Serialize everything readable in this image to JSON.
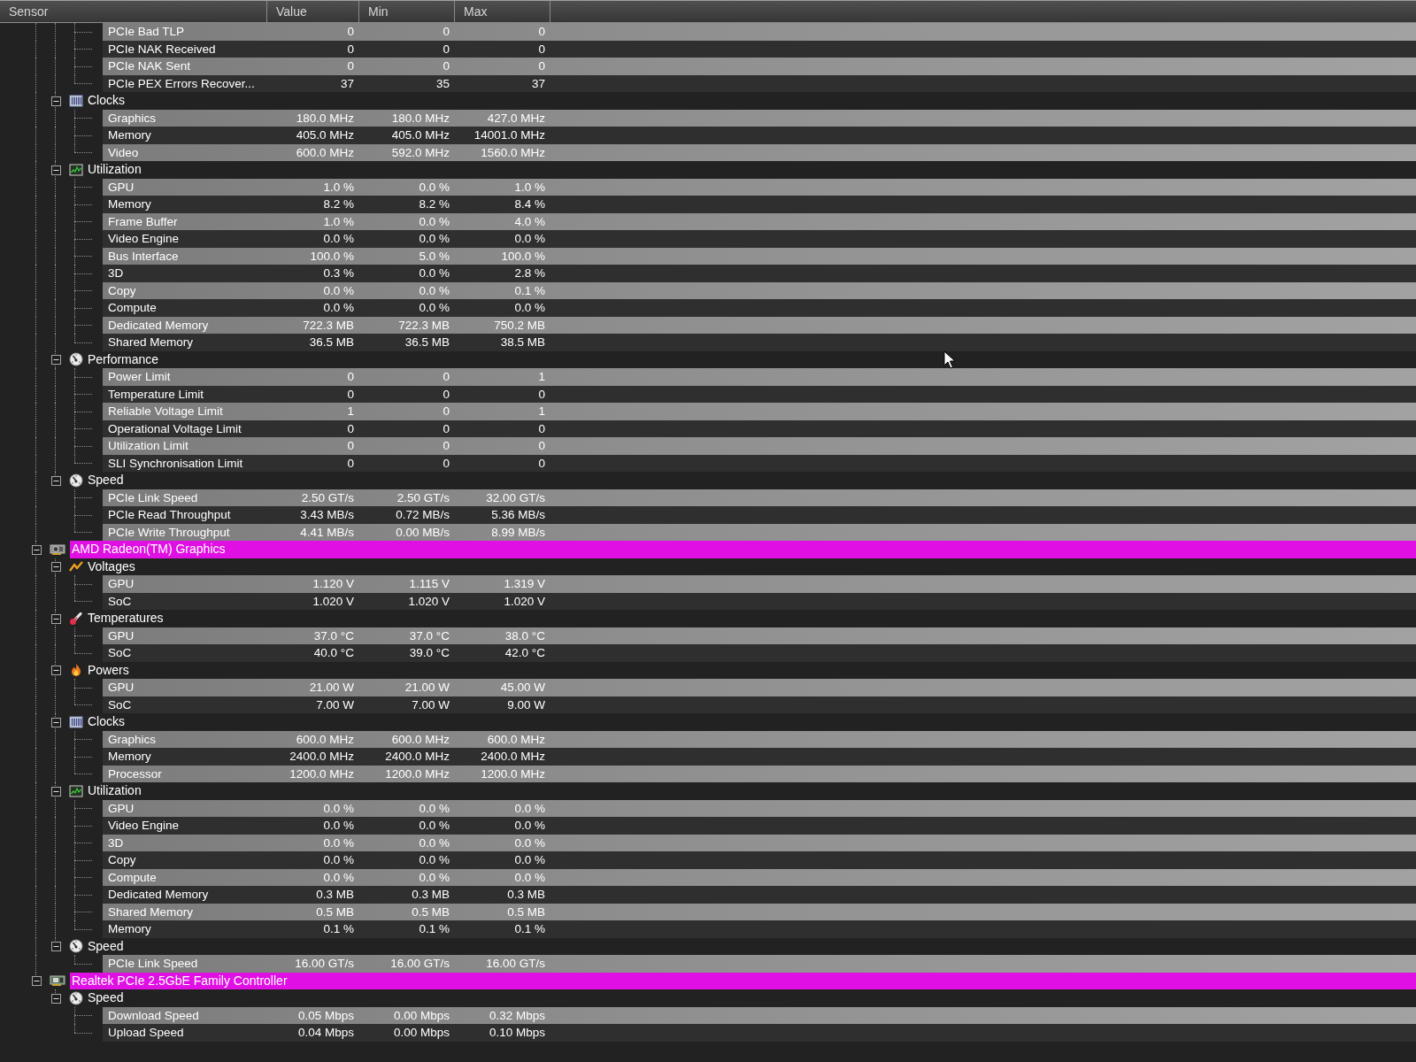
{
  "columns": [
    "Sensor",
    "Value",
    "Min",
    "Max"
  ],
  "tree": [
    {
      "children": [
        {
          "children": [
            {
              "name": "PCIe Bad TLP",
              "value": "0",
              "min": "0",
              "max": "0"
            },
            {
              "name": "PCIe NAK Received",
              "value": "0",
              "min": "0",
              "max": "0"
            },
            {
              "name": "PCIe NAK Sent",
              "value": "0",
              "min": "0",
              "max": "0"
            },
            {
              "name": "PCIe PEX Errors Recover...",
              "value": "37",
              "min": "35",
              "max": "37"
            }
          ]
        },
        {
          "name": "Clocks",
          "kind": "clocks",
          "expanded": true,
          "children": [
            {
              "name": "Graphics",
              "value": "180.0 MHz",
              "min": "180.0 MHz",
              "max": "427.0 MHz"
            },
            {
              "name": "Memory",
              "value": "405.0 MHz",
              "min": "405.0 MHz",
              "max": "14001.0 MHz"
            },
            {
              "name": "Video",
              "value": "600.0 MHz",
              "min": "592.0 MHz",
              "max": "1560.0 MHz"
            }
          ]
        },
        {
          "name": "Utilization",
          "kind": "utilization",
          "expanded": true,
          "children": [
            {
              "name": "GPU",
              "value": "1.0 %",
              "min": "0.0 %",
              "max": "1.0 %"
            },
            {
              "name": "Memory",
              "value": "8.2 %",
              "min": "8.2 %",
              "max": "8.4 %"
            },
            {
              "name": "Frame Buffer",
              "value": "1.0 %",
              "min": "0.0 %",
              "max": "4.0 %"
            },
            {
              "name": "Video Engine",
              "value": "0.0 %",
              "min": "0.0 %",
              "max": "0.0 %"
            },
            {
              "name": "Bus Interface",
              "value": "100.0 %",
              "min": "5.0 %",
              "max": "100.0 %"
            },
            {
              "name": "3D",
              "value": "0.3 %",
              "min": "0.0 %",
              "max": "2.8 %"
            },
            {
              "name": "Copy",
              "value": "0.0 %",
              "min": "0.0 %",
              "max": "0.1 %"
            },
            {
              "name": "Compute",
              "value": "0.0 %",
              "min": "0.0 %",
              "max": "0.0 %"
            },
            {
              "name": "Dedicated Memory",
              "value": "722.3 MB",
              "min": "722.3 MB",
              "max": "750.2 MB"
            },
            {
              "name": "Shared Memory",
              "value": "36.5 MB",
              "min": "36.5 MB",
              "max": "38.5 MB"
            }
          ]
        },
        {
          "name": "Performance",
          "kind": "performance",
          "expanded": true,
          "children": [
            {
              "name": "Power Limit",
              "value": "0",
              "min": "0",
              "max": "1"
            },
            {
              "name": "Temperature Limit",
              "value": "0",
              "min": "0",
              "max": "0"
            },
            {
              "name": "Reliable Voltage Limit",
              "value": "1",
              "min": "0",
              "max": "1"
            },
            {
              "name": "Operational Voltage Limit",
              "value": "0",
              "min": "0",
              "max": "0"
            },
            {
              "name": "Utilization Limit",
              "value": "0",
              "min": "0",
              "max": "0"
            },
            {
              "name": "SLI Synchronisation Limit",
              "value": "0",
              "min": "0",
              "max": "0"
            }
          ]
        },
        {
          "name": "Speed",
          "kind": "speed",
          "expanded": true,
          "children": [
            {
              "name": "PCIe Link Speed",
              "value": "2.50 GT/s",
              "min": "2.50 GT/s",
              "max": "32.00 GT/s"
            },
            {
              "name": "PCIe Read Throughput",
              "value": "3.43 MB/s",
              "min": "0.72 MB/s",
              "max": "5.36 MB/s"
            },
            {
              "name": "PCIe Write Throughput",
              "value": "4.41 MB/s",
              "min": "0.00 MB/s",
              "max": "8.99 MB/s"
            }
          ]
        }
      ]
    },
    {
      "name": "AMD Radeon(TM) Graphics",
      "kind": "gpu",
      "expanded": true,
      "children": [
        {
          "name": "Voltages",
          "kind": "voltages",
          "expanded": true,
          "children": [
            {
              "name": "GPU",
              "value": "1.120 V",
              "min": "1.115 V",
              "max": "1.319 V"
            },
            {
              "name": "SoC",
              "value": "1.020 V",
              "min": "1.020 V",
              "max": "1.020 V"
            }
          ]
        },
        {
          "name": "Temperatures",
          "kind": "temperatures",
          "expanded": true,
          "children": [
            {
              "name": "GPU",
              "value": "37.0 °C",
              "min": "37.0 °C",
              "max": "38.0 °C"
            },
            {
              "name": "SoC",
              "value": "40.0 °C",
              "min": "39.0 °C",
              "max": "42.0 °C"
            }
          ]
        },
        {
          "name": "Powers",
          "kind": "powers",
          "expanded": true,
          "children": [
            {
              "name": "GPU",
              "value": "21.00 W",
              "min": "21.00 W",
              "max": "45.00 W"
            },
            {
              "name": "SoC",
              "value": "7.00 W",
              "min": "7.00 W",
              "max": "9.00 W"
            }
          ]
        },
        {
          "name": "Clocks",
          "kind": "clocks",
          "expanded": true,
          "children": [
            {
              "name": "Graphics",
              "value": "600.0 MHz",
              "min": "600.0 MHz",
              "max": "600.0 MHz"
            },
            {
              "name": "Memory",
              "value": "2400.0 MHz",
              "min": "2400.0 MHz",
              "max": "2400.0 MHz"
            },
            {
              "name": "Processor",
              "value": "1200.0 MHz",
              "min": "1200.0 MHz",
              "max": "1200.0 MHz"
            }
          ]
        },
        {
          "name": "Utilization",
          "kind": "utilization",
          "expanded": true,
          "children": [
            {
              "name": "GPU",
              "value": "0.0 %",
              "min": "0.0 %",
              "max": "0.0 %"
            },
            {
              "name": "Video Engine",
              "value": "0.0 %",
              "min": "0.0 %",
              "max": "0.0 %"
            },
            {
              "name": "3D",
              "value": "0.0 %",
              "min": "0.0 %",
              "max": "0.0 %"
            },
            {
              "name": "Copy",
              "value": "0.0 %",
              "min": "0.0 %",
              "max": "0.0 %"
            },
            {
              "name": "Compute",
              "value": "0.0 %",
              "min": "0.0 %",
              "max": "0.0 %"
            },
            {
              "name": "Dedicated Memory",
              "value": "0.3 MB",
              "min": "0.3 MB",
              "max": "0.3 MB"
            },
            {
              "name": "Shared Memory",
              "value": "0.5 MB",
              "min": "0.5 MB",
              "max": "0.5 MB"
            },
            {
              "name": "Memory",
              "value": "0.1 %",
              "min": "0.1 %",
              "max": "0.1 %"
            }
          ]
        },
        {
          "name": "Speed",
          "kind": "speed",
          "expanded": true,
          "children": [
            {
              "name": "PCIe Link Speed",
              "value": "16.00 GT/s",
              "min": "16.00 GT/s",
              "max": "16.00 GT/s"
            }
          ]
        }
      ]
    },
    {
      "name": "Realtek PCIe 2.5GbE Family Controller",
      "kind": "network",
      "expanded": true,
      "children": [
        {
          "name": "Speed",
          "kind": "speed",
          "expanded": true,
          "children": [
            {
              "name": "Download Speed",
              "value": "0.05 Mbps",
              "min": "0.00 Mbps",
              "max": "0.32 Mbps"
            },
            {
              "name": "Upload Speed",
              "value": "0.04 Mbps",
              "min": "0.00 Mbps",
              "max": "0.10 Mbps"
            }
          ]
        }
      ]
    }
  ]
}
